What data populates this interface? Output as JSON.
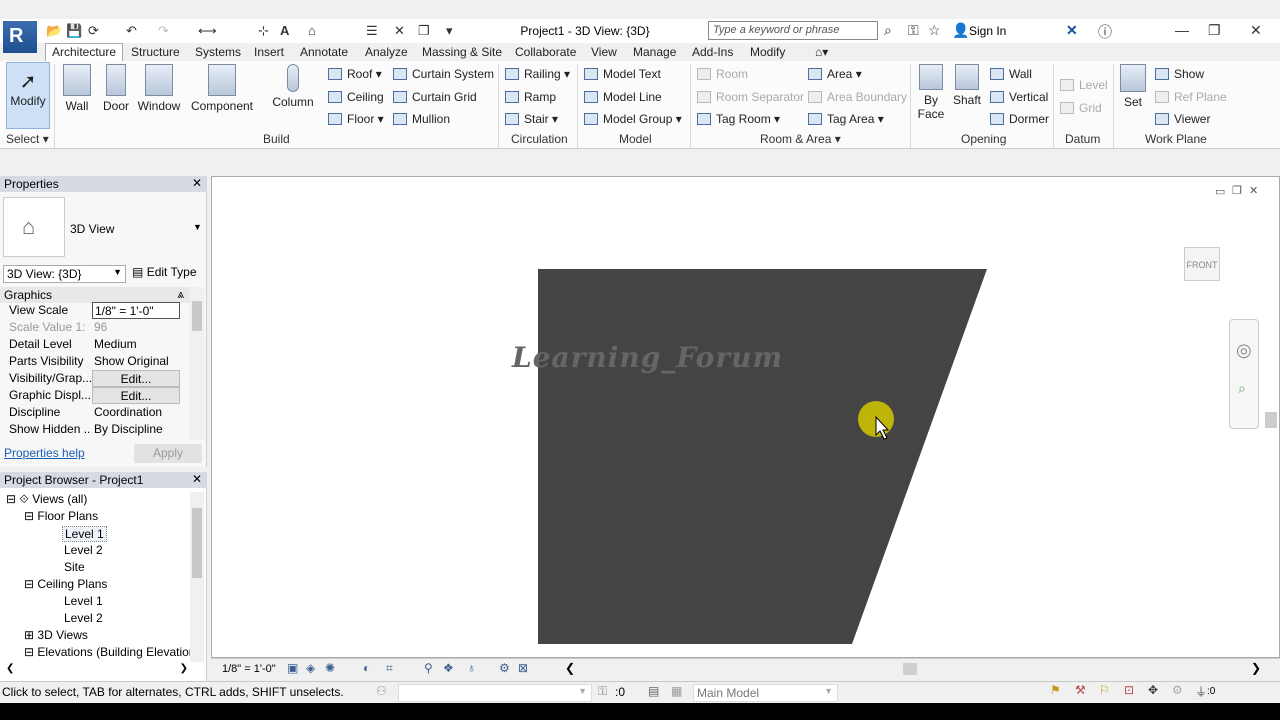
{
  "app": {
    "logo": "R",
    "title": "Project1 - 3D View: {3D}",
    "search_placeholder": "Type a keyword or phrase",
    "sign_in": "Sign In"
  },
  "tabs": [
    "Architecture",
    "Structure",
    "Systems",
    "Insert",
    "Annotate",
    "Analyze",
    "Massing & Site",
    "Collaborate",
    "View",
    "Manage",
    "Add-Ins",
    "Modify"
  ],
  "ribbon": {
    "select": {
      "modify": "Modify",
      "label": "Select"
    },
    "build": {
      "label": "Build",
      "wall": "Wall",
      "door": "Door",
      "window": "Window",
      "component": "Component",
      "column": "Column",
      "roof": "Roof",
      "ceiling": "Ceiling",
      "floor": "Floor",
      "curtain_system": "Curtain System",
      "curtain_grid": "Curtain Grid",
      "mullion": "Mullion"
    },
    "circulation": {
      "label": "Circulation",
      "railing": "Railing",
      "ramp": "Ramp",
      "stair": "Stair"
    },
    "model": {
      "label": "Model",
      "model_text": "Model Text",
      "model_line": "Model Line",
      "model_group": "Model Group"
    },
    "room_area": {
      "label": "Room & Area",
      "room": "Room",
      "room_separator": "Room Separator",
      "tag_room": "Tag Room",
      "area": "Area",
      "area_boundary": "Area Boundary",
      "tag_area": "Tag Area"
    },
    "opening": {
      "label": "Opening",
      "by_face": "By Face",
      "shaft": "Shaft",
      "wall": "Wall",
      "vertical": "Vertical",
      "dormer": "Dormer"
    },
    "datum": {
      "label": "Datum",
      "level": "Level",
      "grid": "Grid"
    },
    "work_plane": {
      "label": "Work Plane",
      "set": "Set",
      "show": "Show",
      "ref_plane": "Ref Plane",
      "viewer": "Viewer"
    }
  },
  "properties": {
    "header": "Properties",
    "type_name": "3D View",
    "selector": "3D View: {3D}",
    "edit_type": "Edit Type",
    "group": "Graphics",
    "rows": [
      {
        "k": "View Scale",
        "v": "1/8\" = 1'-0\""
      },
      {
        "k": "Scale Value    1:",
        "v": "96"
      },
      {
        "k": "Detail Level",
        "v": "Medium"
      },
      {
        "k": "Parts Visibility",
        "v": "Show Original"
      },
      {
        "k": "Visibility/Grap...",
        "v": "Edit..."
      },
      {
        "k": "Graphic Displ...",
        "v": "Edit..."
      },
      {
        "k": "Discipline",
        "v": "Coordination"
      },
      {
        "k": "Show Hidden ...",
        "v": "By Discipline"
      }
    ],
    "help": "Properties help",
    "apply": "Apply"
  },
  "browser": {
    "header": "Project Browser - Project1",
    "items": [
      "Views (all)",
      "Floor Plans",
      "Level 1",
      "Level 2",
      "Site",
      "Ceiling Plans",
      "Level 1",
      "Level 2",
      "3D Views",
      "Elevations (Building Elevation"
    ]
  },
  "canvas": {
    "watermark": "Learning_Forum",
    "viewcube": "FRONT"
  },
  "view_bar": {
    "scale": "1/8\" = 1'-0\""
  },
  "status": {
    "hint": "Click to select, TAB for alternates, CTRL adds, SHIFT unselects.",
    "zero": ":0",
    "workset": "Main Model",
    "filter": ":0"
  },
  "colors": {
    "shape": "#444444",
    "highlight": "#d4c800"
  }
}
